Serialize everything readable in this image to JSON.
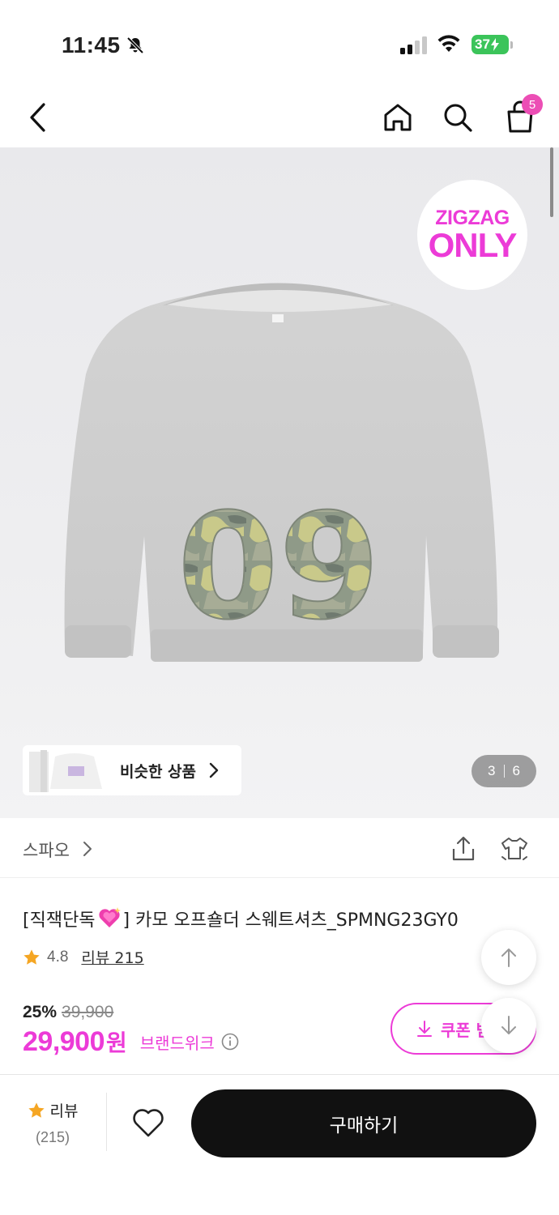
{
  "status_bar": {
    "time": "11:45",
    "battery": "37"
  },
  "nav": {
    "back_icon": "chevron-left-icon",
    "home_icon": "home-icon",
    "search_icon": "search-icon",
    "cart_icon": "shopping-bag-icon",
    "cart_count": "5"
  },
  "hero": {
    "badge_line1": "ZIGZAG",
    "badge_line2": "ONLY",
    "print_text": "09",
    "similar_label": "비슷한 상품",
    "page_current": "3",
    "page_total": "6"
  },
  "brand": {
    "name": "스파오"
  },
  "product": {
    "title_prefix": "[직잭단독",
    "title_suffix": "] 카모 오프숄더 스웨트셔츠_SPMNG23GY0",
    "rating": "4.8",
    "review_link": "리뷰 215",
    "discount": "25%",
    "original_price": "39,900",
    "price": "29,900",
    "currency": "원",
    "brand_week": "브랜드위크"
  },
  "coupon": {
    "label": "쿠폰 받"
  },
  "bottom_bar": {
    "review_label": "리뷰",
    "review_count": "(215)",
    "buy_label": "구매하기"
  },
  "colors": {
    "accent": "#ec3bd7",
    "badge": "#ec4eb5",
    "buy_button": "#111111",
    "star": "#f5a623"
  }
}
